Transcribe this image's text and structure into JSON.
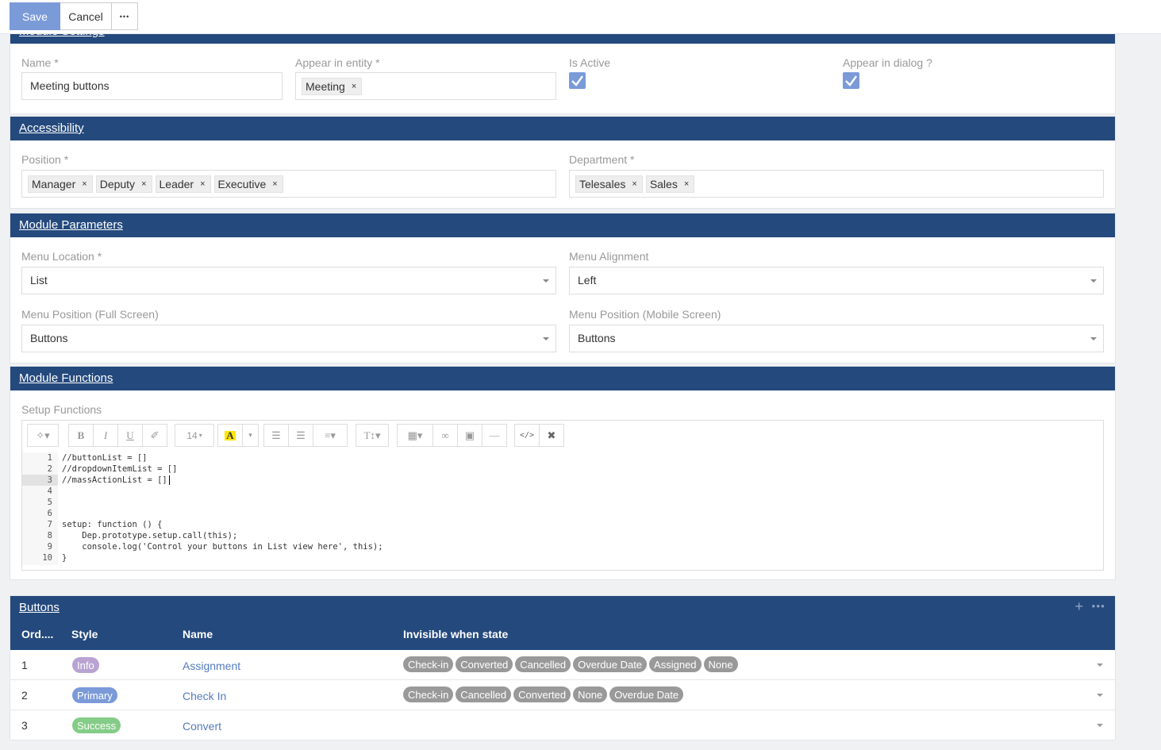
{
  "toolbar": {
    "save_label": "Save",
    "cancel_label": "Cancel",
    "more_label": "•••"
  },
  "module_settings": {
    "title": "Module Settings",
    "name_label": "Name *",
    "name_value": "Meeting buttons",
    "entity_label": "Appear in entity *",
    "entity_tags": [
      "Meeting"
    ],
    "active_label": "Is Active",
    "active_checked": true,
    "dialog_label": "Appear in dialog ?",
    "dialog_checked": true
  },
  "accessibility": {
    "title": "Accessibility",
    "position_label": "Position *",
    "position_tags": [
      "Manager",
      "Deputy",
      "Leader",
      "Executive"
    ],
    "department_label": "Department *",
    "department_tags": [
      "Telesales",
      "Sales"
    ]
  },
  "module_parameters": {
    "title": "Module Parameters",
    "menu_location_label": "Menu Location *",
    "menu_location_value": "List",
    "menu_alignment_label": "Menu Alignment",
    "menu_alignment_value": "Left",
    "menu_full_label": "Menu Position (Full Screen)",
    "menu_full_value": "Buttons",
    "menu_mobile_label": "Menu Position (Mobile Screen)",
    "menu_mobile_value": "Buttons"
  },
  "module_functions": {
    "title": "Module Functions",
    "setup_label": "Setup Functions",
    "font_size": "14",
    "code_lines": [
      "//buttonList = []",
      "//dropdownItemList = []",
      "//massActionList = []",
      "",
      "",
      "",
      "setup: function () {",
      "    Dep.prototype.setup.call(this);",
      "    console.log('Control your buttons in List view here', this);",
      "}"
    ],
    "line_numbers": [
      "1",
      "2",
      "3",
      "4",
      "5",
      "6",
      "7",
      "8",
      "9",
      "10"
    ]
  },
  "buttons": {
    "title": "Buttons",
    "columns": {
      "order": "Ord....",
      "style": "Style",
      "name": "Name",
      "invisible": "Invisible when state"
    },
    "rows": [
      {
        "order": "1",
        "style": "Info",
        "style_color": "#b9a3d3",
        "name": "Assignment",
        "states": [
          "Check-in",
          "Converted",
          "Cancelled",
          "Overdue Date",
          "Assigned",
          "None"
        ]
      },
      {
        "order": "2",
        "style": "Primary",
        "style_color": "#7b9ad8",
        "name": "Check In",
        "states": [
          "Check-in",
          "Cancelled",
          "Converted",
          "None",
          "Overdue Date"
        ]
      },
      {
        "order": "3",
        "style": "Success",
        "style_color": "#84cc87",
        "name": "Convert",
        "states": []
      }
    ]
  }
}
